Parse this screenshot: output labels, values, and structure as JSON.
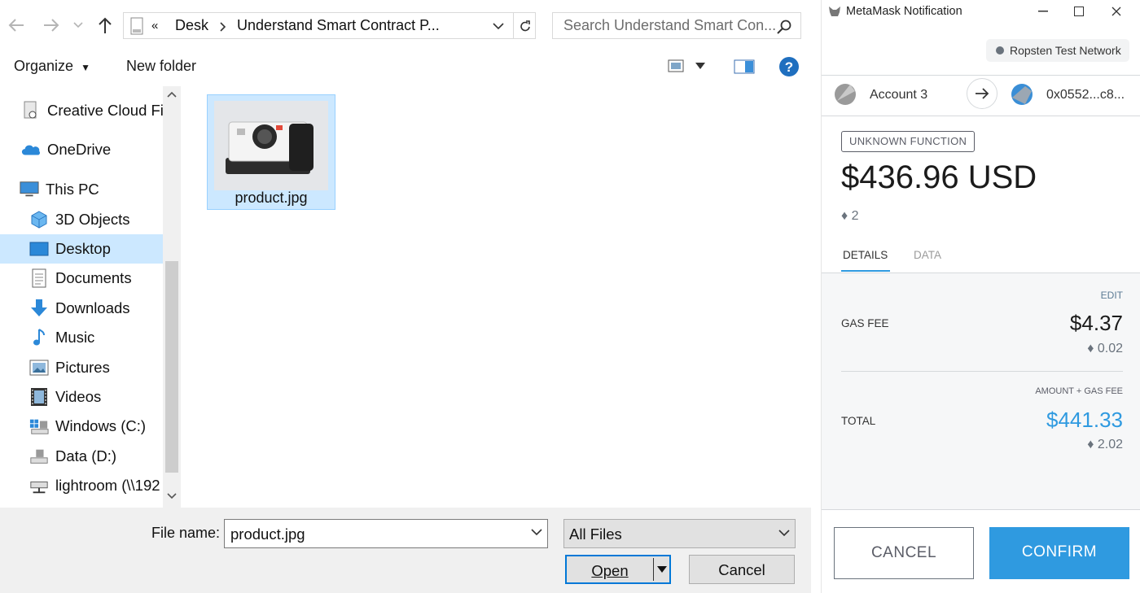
{
  "dialog": {
    "address": {
      "prefix": "«",
      "segments": [
        "Desk",
        "Understand Smart Contract P..."
      ]
    },
    "search_placeholder": "Search Understand Smart Con...",
    "toolbar": {
      "organize": "Organize",
      "new_folder": "New folder"
    },
    "nav_items": [
      {
        "label": "Creative Cloud Fil",
        "icon": "creative-cloud-icon"
      },
      {
        "label": "OneDrive",
        "icon": "onedrive-icon"
      },
      {
        "label": "This PC",
        "icon": "this-pc-icon"
      },
      {
        "label": "3D Objects",
        "icon": "3d-objects-icon"
      },
      {
        "label": "Desktop",
        "icon": "desktop-icon",
        "selected": true
      },
      {
        "label": "Documents",
        "icon": "documents-icon"
      },
      {
        "label": "Downloads",
        "icon": "downloads-icon"
      },
      {
        "label": "Music",
        "icon": "music-icon"
      },
      {
        "label": "Pictures",
        "icon": "pictures-icon"
      },
      {
        "label": "Videos",
        "icon": "videos-icon"
      },
      {
        "label": "Windows (C:)",
        "icon": "windows-drive-icon"
      },
      {
        "label": "Data (D:)",
        "icon": "drive-icon"
      },
      {
        "label": "lightroom (\\\\192",
        "icon": "network-drive-icon"
      }
    ],
    "files": [
      {
        "name": "product.jpg"
      }
    ],
    "footer": {
      "file_name_label": "File name:",
      "file_name_value": "product.jpg",
      "filter_value": "All Files",
      "open_label": "Open",
      "cancel_label": "Cancel"
    }
  },
  "metamask": {
    "window_title": "MetaMask Notification",
    "network": "Ropsten Test Network",
    "from_account": "Account 3",
    "to_address": "0x0552...c8...",
    "function_badge": "UNKNOWN FUNCTION",
    "amount_usd": "$436.96 USD",
    "amount_eth": "♦ 2",
    "tabs": [
      "DETAILS",
      "DATA"
    ],
    "edit_label": "EDIT",
    "gas_fee": {
      "label": "GAS FEE",
      "usd": "$4.37",
      "eth": "♦ 0.02"
    },
    "total": {
      "caption": "AMOUNT + GAS FEE",
      "label": "TOTAL",
      "usd": "$441.33",
      "eth": "♦ 2.02"
    },
    "buttons": {
      "cancel": "CANCEL",
      "confirm": "CONFIRM"
    },
    "colors": {
      "accent": "#2f9ae0",
      "confirm_bg": "#2f9ae0",
      "selection": "#cce8ff"
    }
  }
}
